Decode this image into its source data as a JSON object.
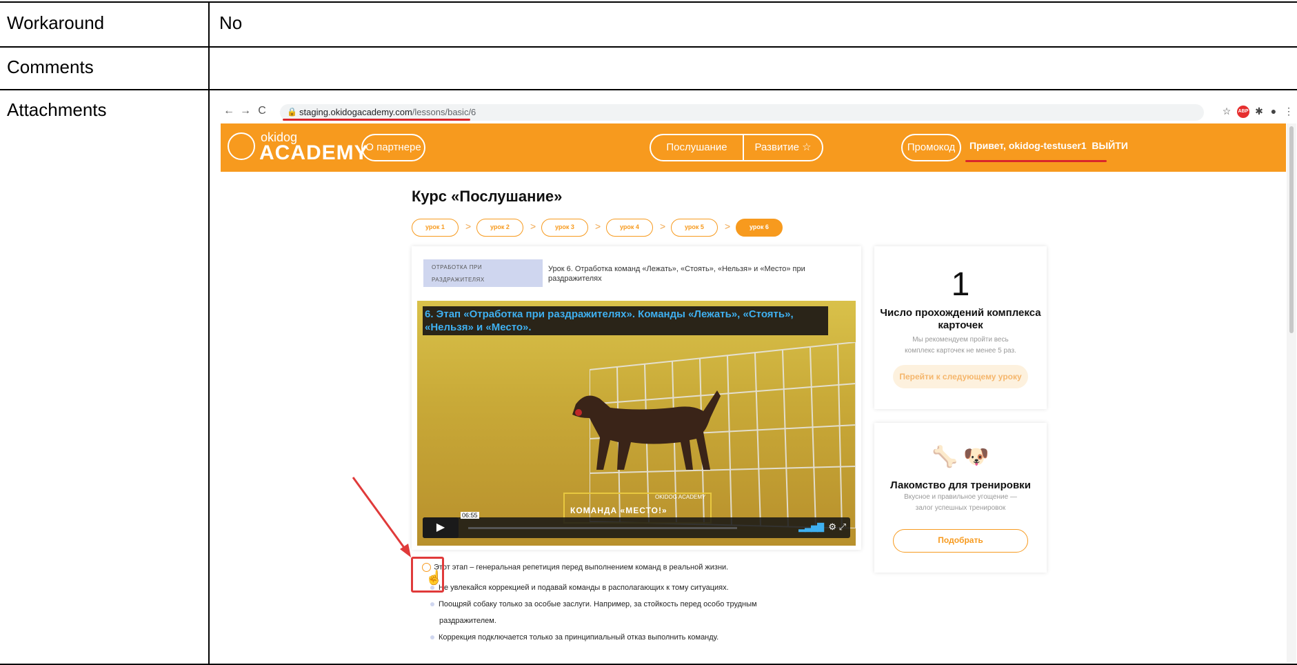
{
  "report": {
    "rows": [
      {
        "label": "Workaround",
        "value": "No"
      },
      {
        "label": "Comments",
        "value": ""
      },
      {
        "label": "Attachments",
        "value": ""
      }
    ]
  },
  "browser": {
    "url_host": "staging.okidogacademy.com",
    "url_path": "/lessons/basic/6",
    "back_icon": "←",
    "forward_icon": "→",
    "reload_icon": "C",
    "extensions": [
      "star-icon",
      "abp-icon",
      "puzzle-icon",
      "profile-icon",
      "menu-icon"
    ]
  },
  "site": {
    "logo_top": "okidog",
    "logo_bottom": "ACADEMY",
    "partner_button": "О партнере",
    "nav": [
      "Послушание",
      "Развитие ☆"
    ],
    "promo_button": "Промокод",
    "greeting": "Привет, okidog-testuser1",
    "logout": "ВЫЙТИ",
    "accent_color": "#f79a1e"
  },
  "course": {
    "title": "Курс «Послушание»",
    "lessons": [
      "урок 1",
      "урок 2",
      "урок 3",
      "урок 4",
      "урок 5",
      "урок 6"
    ],
    "active_lesson": 6
  },
  "lesson": {
    "tag_line1": "ОТРАБОТКА ПРИ",
    "tag_line2": "РАЗДРАЖИТЕЛЯХ",
    "description": "Урок 6. Отработка команд «Лежать», «Стоять», «Нельзя» и «Место» при раздражителях",
    "video_title": "6. Этап «Отработка при раздражителях». Команды «Лежать», «Стоять», «Нельзя» и «Место».",
    "overlay_small": "OKIDOG ACADEMY",
    "overlay_text": "КОМАНДА «МЕСТО!»",
    "time": "06:55",
    "bullets": [
      "Этот этап – генеральная репетиция перед выполнением команд в реальной жизни.",
      "Не увлекайся коррекцией и подавай команды в располагающих к тому ситуациях.",
      "Поощряй собаку только за особые заслуги. Например, за стойкость перед особо трудным",
      "раздражителем.",
      "Коррекция подключается только за принципиальный отказ выполнить команду."
    ]
  },
  "card1": {
    "number": "1",
    "title": "Число прохождений комплекса карточек",
    "subtitle": "Мы рекомендуем пройти весь комплекс карточек не менее 5 раз.",
    "button": "Перейти к следующему уроку"
  },
  "card2": {
    "emoji": "🦴 🐶",
    "title": "Лакомство для тренировки",
    "subtitle": "Вкусное и правильное угощение — залог успешных тренировок",
    "button": "Подобрать"
  }
}
